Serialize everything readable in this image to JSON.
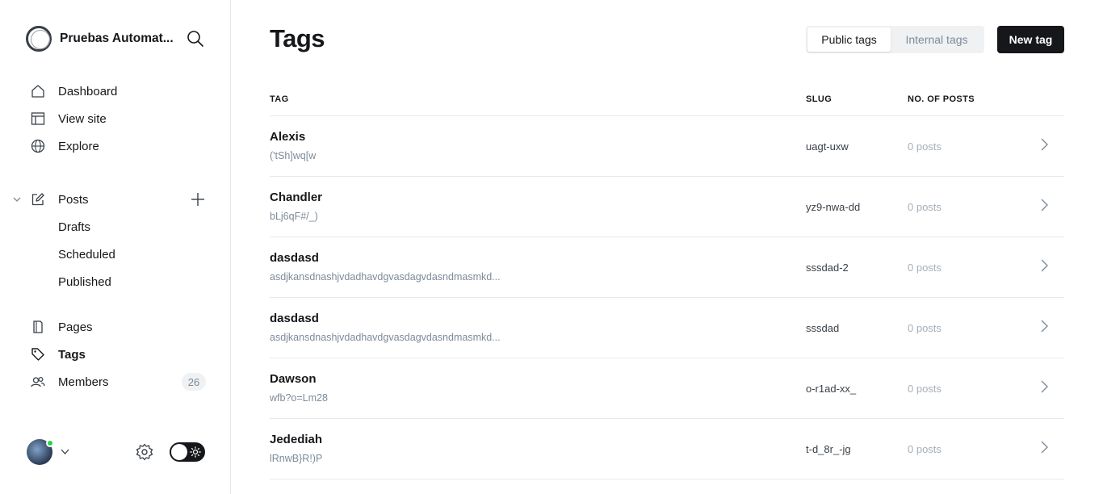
{
  "sidebar": {
    "site_name": "Pruebas Automat...",
    "nav": [
      {
        "label": "Dashboard",
        "icon": "house-icon"
      },
      {
        "label": "View site",
        "icon": "layout-icon"
      },
      {
        "label": "Explore",
        "icon": "globe-icon"
      }
    ],
    "posts": {
      "label": "Posts",
      "icon": "pencil-square-icon",
      "children": [
        "Drafts",
        "Scheduled",
        "Published"
      ]
    },
    "lower_nav": [
      {
        "label": "Pages",
        "icon": "page-icon"
      },
      {
        "label": "Tags",
        "icon": "tag-icon",
        "active": true
      },
      {
        "label": "Members",
        "icon": "members-icon",
        "badge": "26"
      }
    ]
  },
  "header": {
    "title": "Tags",
    "tabs": [
      "Public tags",
      "Internal tags"
    ],
    "active_tab": "Public tags",
    "new_button": "New tag"
  },
  "table": {
    "columns": [
      "TAG",
      "SLUG",
      "NO. OF POSTS"
    ],
    "rows": [
      {
        "name": "Alexis",
        "description": "('tSh]wq[w",
        "slug": "uagt-uxw",
        "posts": "0 posts"
      },
      {
        "name": "Chandler",
        "description": "bLj6qF#/_)",
        "slug": "yz9-nwa-dd",
        "posts": "0 posts"
      },
      {
        "name": "dasdasd",
        "description": "asdjkansdnashjvdadhavdgvasdagvdasndmasmkd...",
        "slug": "sssdad-2",
        "posts": "0 posts"
      },
      {
        "name": "dasdasd",
        "description": "asdjkansdnashjvdadhavdgvasdagvdasndmasmkd...",
        "slug": "sssdad",
        "posts": "0 posts"
      },
      {
        "name": "Dawson",
        "description": "wfb?o=Lm28",
        "slug": "o-r1ad-xx_",
        "posts": "0 posts"
      },
      {
        "name": "Jedediah",
        "description": "lRnwB}R!)P",
        "slug": "t-d_8r_-jg",
        "posts": "0 posts"
      }
    ]
  },
  "colors": {
    "text": "#15171a",
    "muted": "#7c8b9a",
    "online": "#30cf43",
    "button_dark": "#15171a"
  }
}
